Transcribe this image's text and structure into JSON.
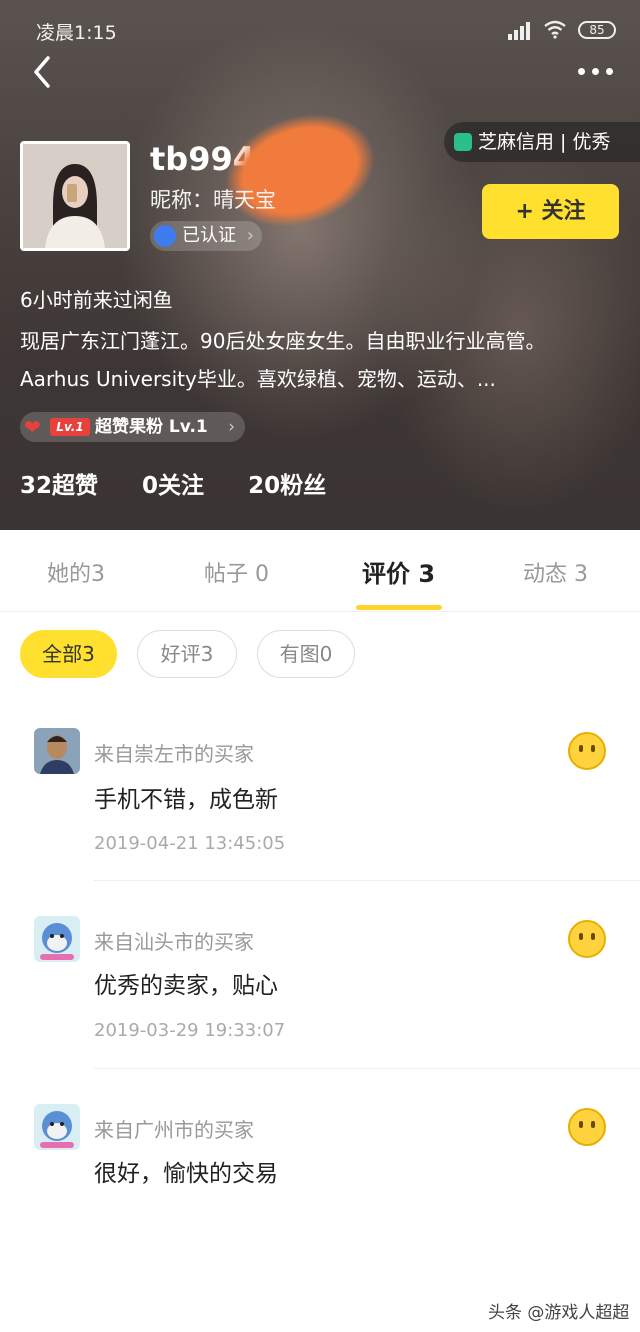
{
  "status_bar": {
    "time": "凌晨1:15",
    "battery": "85"
  },
  "profile": {
    "username": "tb994",
    "nickname": "昵称：晴天宝",
    "verified_label": "已认证",
    "credit_label": "芝麻信用 | 优秀",
    "follow_label": "+ 关注",
    "last_seen": "6小时前来过闲鱼",
    "bio": "现居广东江门蓬江。90后处女座女生。自由职业行业高管。Aarhus University毕业。喜欢绿植、宠物、运动、...",
    "fan_level_tag": "Lv.1",
    "fan_badge": "超赞果粉 Lv.1",
    "stats": [
      "32超赞",
      "0关注",
      "20粉丝"
    ]
  },
  "tabs": [
    {
      "label": "她的3"
    },
    {
      "label": "帖子 0"
    },
    {
      "label": "评价 3"
    },
    {
      "label": "动态 3"
    }
  ],
  "filters": [
    {
      "label": "全部3"
    },
    {
      "label": "好评3"
    },
    {
      "label": "有图0"
    }
  ],
  "reviews": [
    {
      "source": "来自崇左市的买家",
      "text": "手机不错，成色新",
      "date": "2019-04-21 13:45:05"
    },
    {
      "source": "来自汕头市的买家",
      "text": "优秀的卖家，贴心",
      "date": "2019-03-29 19:33:07"
    },
    {
      "source": "来自广州市的买家",
      "text": "很好，愉快的交易",
      "date": ""
    }
  ],
  "watermark": "头条 @游戏人超超",
  "colors": {
    "accent": "#ffe02e",
    "credit": "#2bbf8a",
    "verified": "#3f7cf0"
  }
}
